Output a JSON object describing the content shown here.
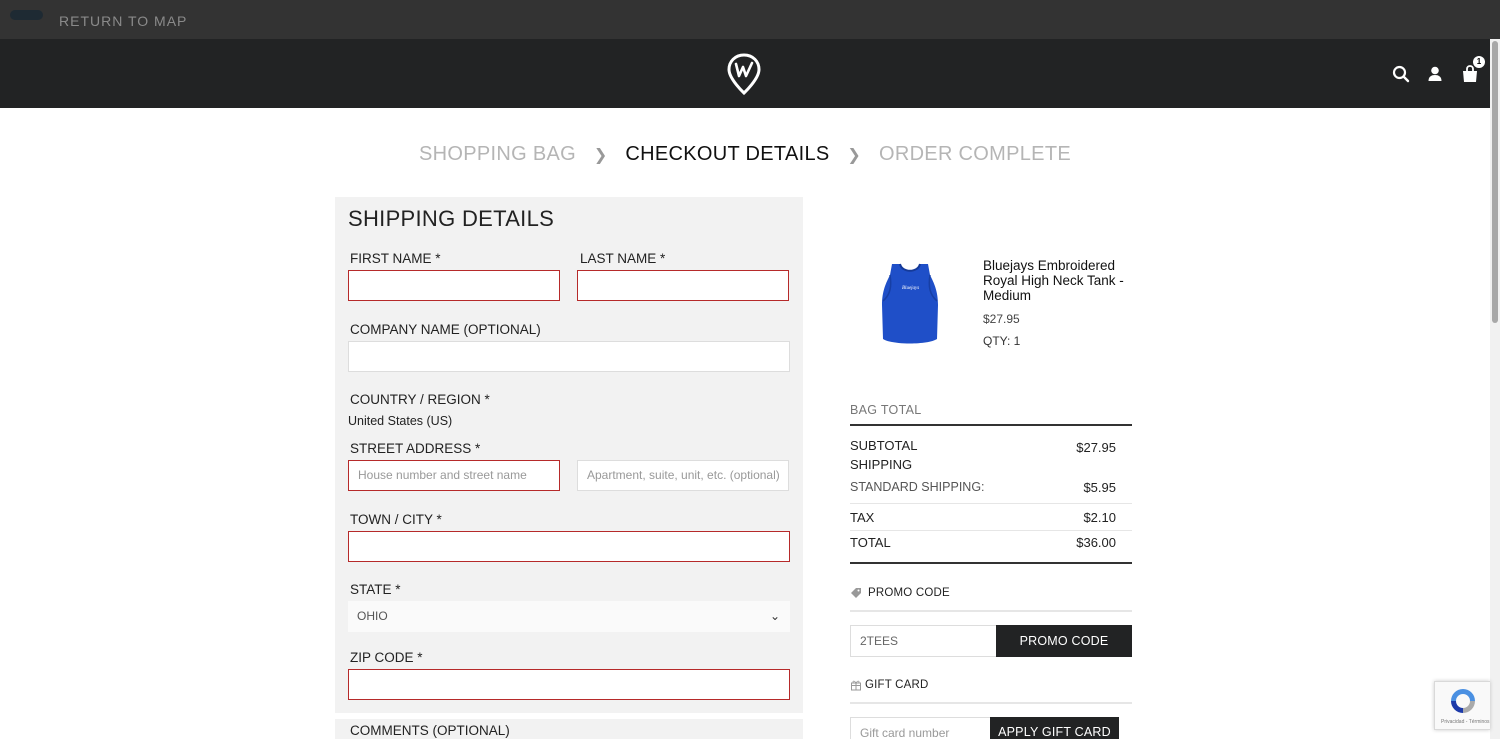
{
  "topbar": {
    "return_label": "RETURN TO MAP"
  },
  "header": {
    "logo_icon": "w-pin-logo-icon",
    "icons": [
      "search-icon",
      "user-icon",
      "shopping-bag-icon"
    ],
    "bag_count": "1"
  },
  "breadcrumb": {
    "steps": [
      "SHOPPING BAG",
      "CHECKOUT DETAILS",
      "ORDER COMPLETE"
    ],
    "active_step": "CHECKOUT DETAILS"
  },
  "shipping": {
    "title": "SHIPPING DETAILS",
    "first_name_label": "FIRST NAME *",
    "first_name_value": "",
    "last_name_label": "LAST NAME *",
    "last_name_value": "",
    "company_label": "COMPANY NAME (OPTIONAL)",
    "company_value": "",
    "country_label": "COUNTRY / REGION *",
    "country_value": "United States (US)",
    "street_label": "STREET ADDRESS *",
    "street_placeholder": "House number and street name",
    "apt_placeholder": "Apartment, suite, unit, etc. (optional)",
    "city_label": "TOWN / CITY *",
    "city_value": "",
    "state_label": "STATE *",
    "state_value": "OHIO",
    "zip_label": "ZIP CODE *",
    "zip_value": "",
    "comments_label": "COMMENTS (OPTIONAL)"
  },
  "product": {
    "name": "Bluejays Embroidered Royal High Neck Tank - Medium",
    "price": "$27.95",
    "qty": "QTY: 1"
  },
  "bag_total": {
    "title": "BAG TOTAL",
    "subtotal_label": "SUBTOTAL",
    "subtotal_value": "$27.95",
    "shipping_label": "SHIPPING",
    "standard_shipping_label": "STANDARD SHIPPING:",
    "standard_shipping_value": "$5.95",
    "tax_label": "TAX",
    "tax_value": "$2.10",
    "total_label": "TOTAL",
    "total_value": "$36.00"
  },
  "promo": {
    "label": "PROMO CODE",
    "input_value": "2TEES",
    "button_label": "PROMO CODE"
  },
  "gift": {
    "label": "GIFT CARD",
    "input_placeholder": "Gift card number",
    "button_label": "APPLY GIFT CARD"
  },
  "recaptcha": {
    "text": "Privacidad - Términos"
  },
  "colors": {
    "header_bg": "#222324",
    "topbar_bg": "#333333",
    "error_border": "#b62a2a",
    "panel_bg": "#f2f2f2",
    "product_blue": "#1f4fc8"
  }
}
